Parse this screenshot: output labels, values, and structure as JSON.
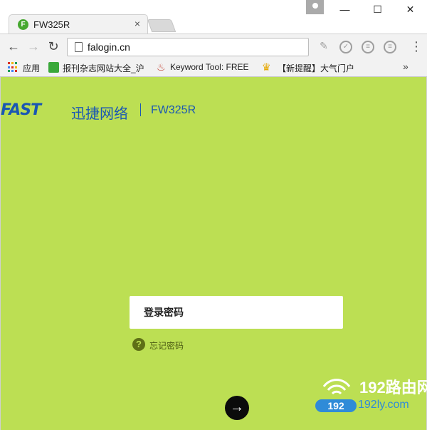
{
  "browser": {
    "tab_title": "FW325R",
    "tab_favicon_letter": "F",
    "tab_close": "×",
    "window_minimize": "—",
    "window_maximize": "☐",
    "window_close": "✕",
    "url": "falogin.cn",
    "menu_dots": "⋮",
    "bookmarks": [
      {
        "label": "应用"
      },
      {
        "label": "报刊杂志网站大全_沪"
      },
      {
        "label": "Keyword Tool: FREE"
      },
      {
        "label": "【新提醒】大气门户"
      }
    ],
    "bookmarks_more": "»"
  },
  "page": {
    "logo": "FAST",
    "brand_cn": "迅捷网络",
    "model": "FW325R",
    "password_placeholder": "登录密码",
    "forgot_icon": "?",
    "forgot_label": "忘记密码",
    "login_arrow": "→"
  },
  "watermark": {
    "title": "192路由网",
    "badge": "192",
    "url": "192ly.com"
  },
  "colors": {
    "page_bg": "#bcdf53",
    "brand_blue": "#1a57b3",
    "button_dark": "#0b0b0b"
  }
}
